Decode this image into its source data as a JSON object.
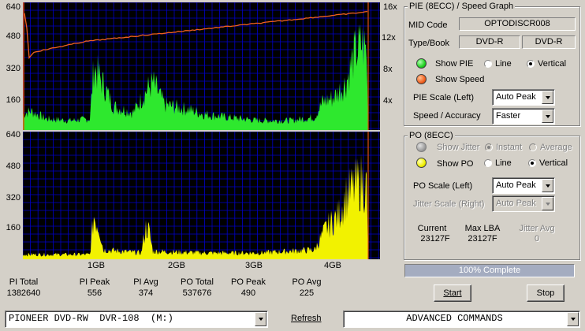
{
  "pie_chart": {
    "left_axis": [
      "640",
      "480",
      "320",
      "160"
    ],
    "right_axis": [
      "16x",
      "12x",
      "8x",
      "4x"
    ]
  },
  "po_chart": {
    "left_axis": [
      "640",
      "480",
      "320",
      "160"
    ],
    "x_axis": [
      "1GB",
      "2GB",
      "3GB",
      "4GB"
    ]
  },
  "stats": {
    "pi_total_label": "PI Total",
    "pi_total": "1382640",
    "pi_peak_label": "PI Peak",
    "pi_peak": "556",
    "pi_avg_label": "PI Avg",
    "pi_avg": "374",
    "po_total_label": "PO Total",
    "po_total": "537676",
    "po_peak_label": "PO Peak",
    "po_peak": "490",
    "po_avg_label": "PO Avg",
    "po_avg": "225"
  },
  "pie_group": {
    "title": "PIE (8ECC) / Speed Graph",
    "mid_code_label": "MID Code",
    "mid_code": "OPTODISCR008",
    "type_book_label": "Type/Book",
    "type": "DVD-R",
    "book": "DVD-R",
    "show_pie": "Show PIE",
    "line": "Line",
    "vertical": "Vertical",
    "show_speed": "Show Speed",
    "pie_scale_label": "PIE Scale (Left)",
    "pie_scale": "Auto Peak",
    "speed_accuracy_label": "Speed / Accuracy",
    "speed_accuracy": "Faster",
    "pie_color": "#30e030",
    "speed_color": "#f06020"
  },
  "po_group": {
    "title": "PO (8ECC)",
    "show_jitter": "Show Jitter",
    "instant": "Instant",
    "average": "Average",
    "show_po": "Show PO",
    "line": "Line",
    "vertical": "Vertical",
    "po_scale_label": "PO Scale (Left)",
    "po_scale": "Auto Peak",
    "jitter_scale_label": "Jitter Scale (Right)",
    "jitter_scale": "Auto Peak",
    "current_label": "Current",
    "current": "23127F",
    "max_lba_label": "Max LBA",
    "max_lba": "23127F",
    "jitter_avg_label": "Jitter Avg",
    "jitter_avg": "0",
    "po_color": "#f0f000"
  },
  "progress": {
    "text": "100% Complete",
    "fraction": 1.0
  },
  "buttons": {
    "start": "Start",
    "stop": "Stop",
    "refresh": "Refresh"
  },
  "drive": {
    "selected": "PIONEER DVD-RW  DVR-108  (M:)"
  },
  "commands": {
    "selected": "ADVANCED COMMANDS"
  }
}
